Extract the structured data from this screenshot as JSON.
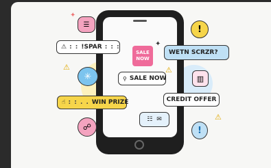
{
  "labels": {
    "spar": "!SPAR",
    "wetn": "WETN SCRZR?",
    "sale_tile_line1": "SALE",
    "sale_tile_line2": "NOW",
    "sale_now": "SALE NOW",
    "credit_offer": "CREDIT OFFER",
    "win_prize_dots": ": : . .",
    "win_prize": "WIN PRIZE",
    "spar_dots_left": ": :",
    "spar_dots_right": ": : :"
  },
  "icons": {
    "warning": "⚠",
    "exclaim": "!",
    "snowflake": "✳",
    "hand": "☝",
    "cursor": "☍",
    "mail": "✉",
    "chat": "☷",
    "chart": "▥",
    "document": "☰",
    "sparkle": "✦"
  },
  "colors": {
    "pink": "#f4a3bf",
    "blue": "#7cc4ee",
    "yellow": "#f6d54a",
    "light_yellow": "#fdf1b8"
  }
}
